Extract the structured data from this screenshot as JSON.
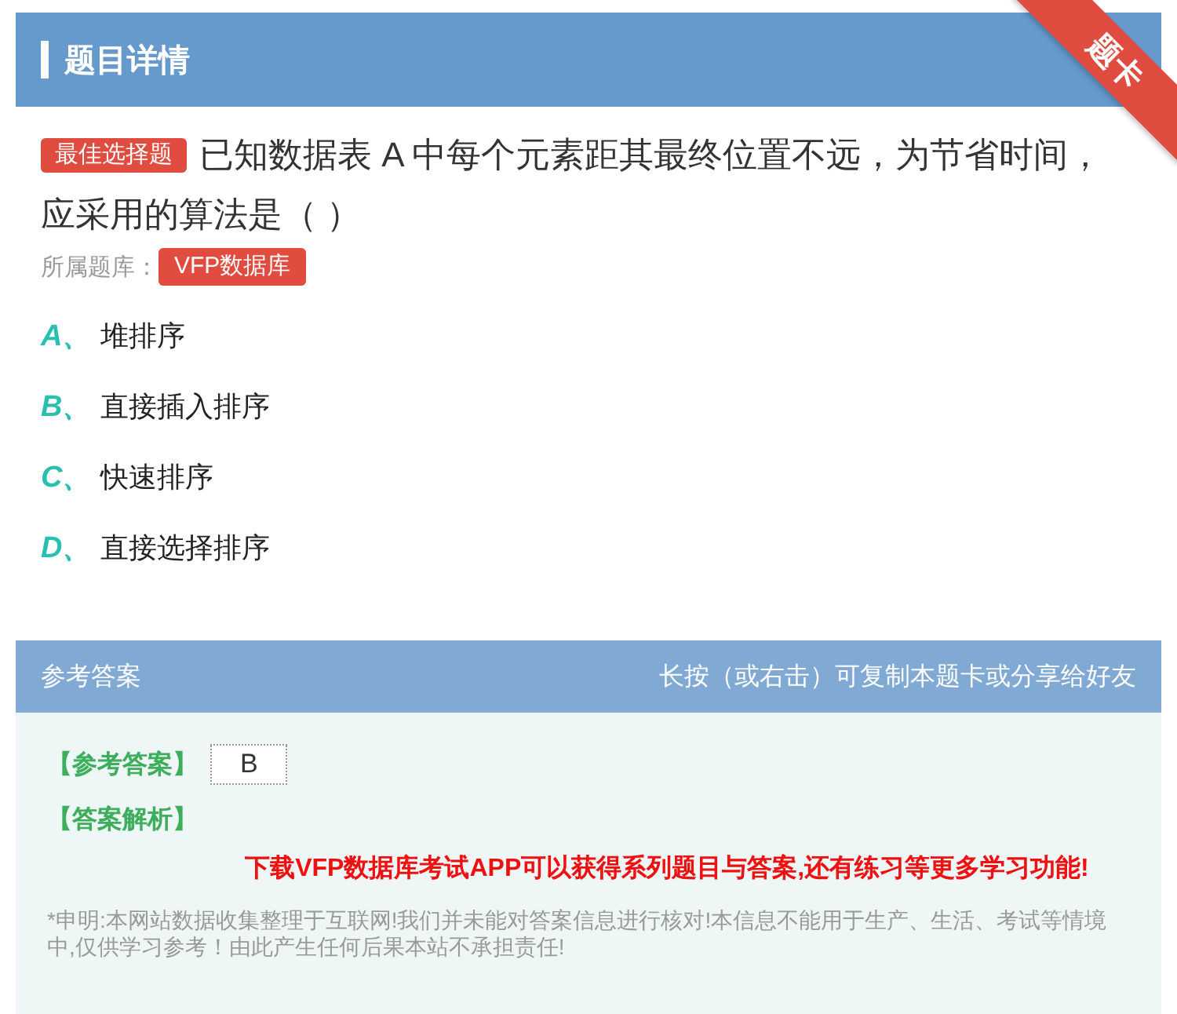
{
  "header": {
    "title": "题目详情",
    "ribbon": "题卡"
  },
  "question": {
    "type_badge": "最佳选择题",
    "text": "已知数据表 A 中每个元素距其最终位置不远，为节省时间，应采用的算法是（    ）",
    "bank_label": "所属题库：",
    "bank": "VFP数据库"
  },
  "options": [
    {
      "letter": "A、",
      "text": "堆排序"
    },
    {
      "letter": "B、",
      "text": "直接插入排序"
    },
    {
      "letter": "C、",
      "text": "快速排序"
    },
    {
      "letter": "D、",
      "text": "直接选择排序"
    }
  ],
  "answer": {
    "title": "参考答案",
    "hint": "长按（或右击）可复制本题卡或分享给好友",
    "answer_label": "【参考答案】",
    "answer_value": "B",
    "analysis_label": "【答案解析】",
    "promo": "下载VFP数据库考试APP可以获得系列题目与答案,还有练习等更多学习功能!",
    "disclaimer": "*申明:本网站数据收集整理于互联网!我们并未能对答案信息进行核对!本信息不能用于生产、生活、考试等情境中,仅供学习参考！由此产生任何后果本站不承担责任!"
  }
}
